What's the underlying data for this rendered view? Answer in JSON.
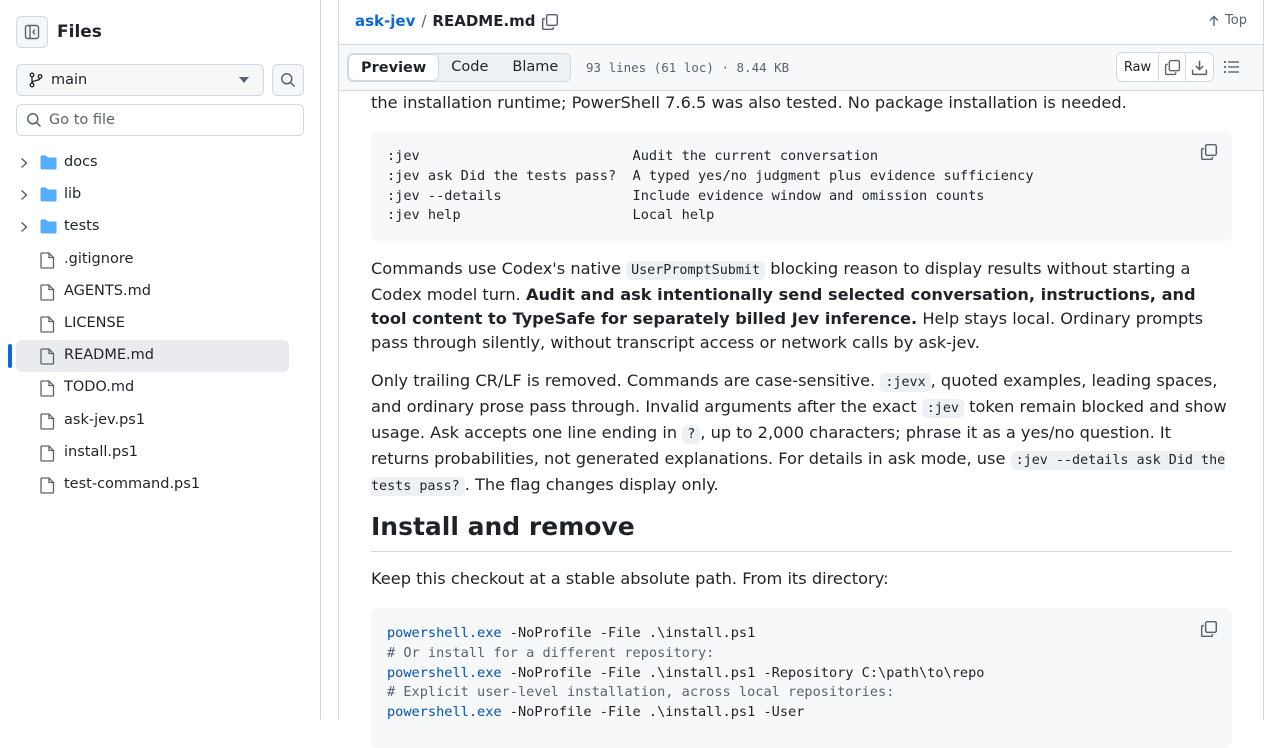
{
  "sidebar": {
    "title": "Files",
    "branch": "main",
    "goto_placeholder": "Go to file",
    "items": [
      {
        "label": "docs",
        "type": "folder"
      },
      {
        "label": "lib",
        "type": "folder"
      },
      {
        "label": "tests",
        "type": "folder"
      },
      {
        "label": ".gitignore",
        "type": "file"
      },
      {
        "label": "AGENTS.md",
        "type": "file"
      },
      {
        "label": "LICENSE",
        "type": "file"
      },
      {
        "label": "README.md",
        "type": "file",
        "selected": true
      },
      {
        "label": "TODO.md",
        "type": "file"
      },
      {
        "label": "ask-jev.ps1",
        "type": "file"
      },
      {
        "label": "install.ps1",
        "type": "file"
      },
      {
        "label": "test-command.ps1",
        "type": "file"
      }
    ]
  },
  "header": {
    "repo": "ask-jev",
    "separator": "/",
    "file": "README.md",
    "top_label": "Top"
  },
  "toolbar": {
    "tabs": [
      "Preview",
      "Code",
      "Blame"
    ],
    "active_tab": "Preview",
    "meta": "93 lines (61 loc) · 8.44 KB",
    "raw_label": "Raw"
  },
  "readme": {
    "intro_tail": "the installation runtime; PowerShell 7.6.5 was also tested. No package installation is needed.",
    "commands": [
      {
        "cmd": ":jev",
        "desc": "Audit the current conversation"
      },
      {
        "cmd": ":jev ask Did the tests pass?",
        "desc": "A typed yes/no judgment plus evidence sufficiency"
      },
      {
        "cmd": ":jev --details",
        "desc": "Include evidence window and omission counts"
      },
      {
        "cmd": ":jev help",
        "desc": "Local help"
      }
    ],
    "p1": {
      "a": "Commands use Codex's native ",
      "code": "UserPromptSubmit",
      "b": " blocking reason to display results without starting a Codex model turn. ",
      "bold": "Audit and ask intentionally send selected conversation, instructions, and tool content to TypeSafe for separately billed Jev inference.",
      "c": " Help stays local. Ordinary prompts pass through silently, without transcript access or network calls by ask-jev."
    },
    "p2": {
      "a": "Only trailing CR/LF is removed. Commands are case-sensitive. ",
      "code1": ":jevx",
      "b": ", quoted examples, leading spaces, and ordinary prose pass through. Invalid arguments after the exact ",
      "code2": ":jev",
      "c": " token remain blocked and show usage. Ask accepts one line ending in ",
      "code3": "?",
      "d": ", up to 2,000 characters; phrase it as a yes/no question. It returns probabilities, not generated explanations. For details in ask mode, use ",
      "code4": ":jev --details ask Did the tests pass?",
      "e": ". The flag changes display only."
    },
    "h2": "Install and remove",
    "p3": "Keep this checkout at a stable absolute path. From its directory:",
    "install_lines": [
      {
        "kind": "cmd",
        "exe": "powershell.exe",
        "rest": " -NoProfile -File .\\install.ps1"
      },
      {
        "kind": "comment",
        "text": "# Or install for a different repository:"
      },
      {
        "kind": "cmd",
        "exe": "powershell.exe",
        "rest": " -NoProfile -File .\\install.ps1 -Repository C:\\path\\to\\repo"
      },
      {
        "kind": "comment",
        "text": "# Explicit user-level installation, across local repositories:"
      },
      {
        "kind": "cmd",
        "exe": "powershell.exe",
        "rest": " -NoProfile -File .\\install.ps1 -User"
      }
    ]
  },
  "colors": {
    "accent": "#0969da",
    "folder": "#54aeff",
    "border": "#d1d9e0"
  }
}
